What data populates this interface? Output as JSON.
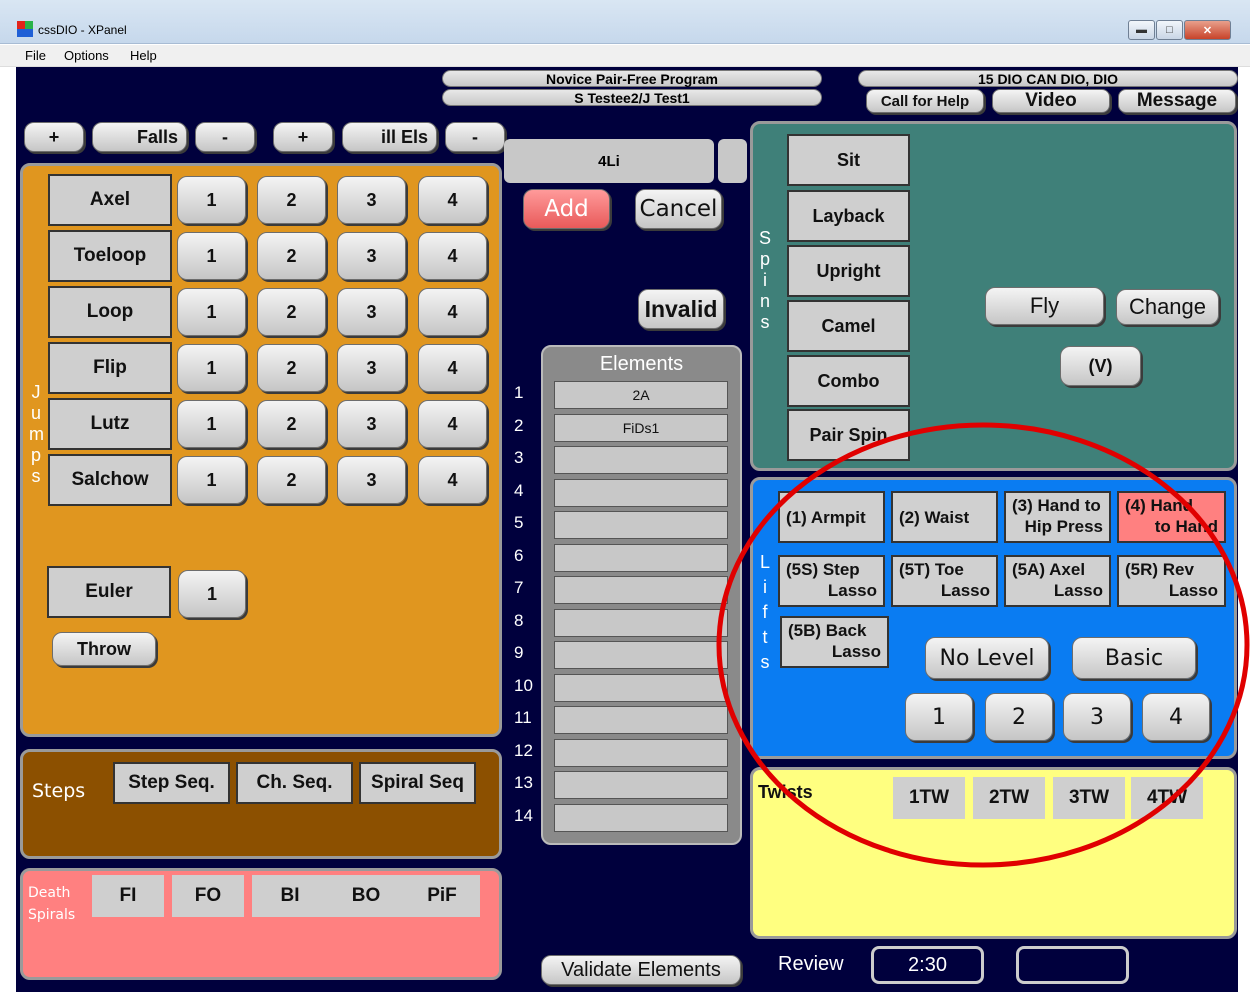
{
  "window": {
    "title": "cssDIO - XPanel",
    "controls": [
      "minimize-icon",
      "maximize-icon",
      "close-icon"
    ]
  },
  "menu": [
    "File",
    "Options",
    "Help"
  ],
  "header": {
    "program": "Novice Pair-Free Program",
    "skaters": "S Testee2/J Test1",
    "station": "15 DIO CAN DIO, DIO",
    "call_help": "Call for Help",
    "video": "Video",
    "message": "Message"
  },
  "counters": {
    "plus": "+",
    "minus": "-",
    "falls": "Falls",
    "ill_els": "ill Els"
  },
  "current_element": "4Li",
  "actions": {
    "add": "Add",
    "cancel": "Cancel",
    "invalid": "Invalid",
    "validate": "Validate Elements"
  },
  "jumps": {
    "label": [
      "J",
      "u",
      "m",
      "p",
      "s"
    ],
    "rows": [
      {
        "name": "Axel",
        "levels": [
          "1",
          "2",
          "3",
          "4"
        ]
      },
      {
        "name": "Toeloop",
        "levels": [
          "1",
          "2",
          "3",
          "4"
        ]
      },
      {
        "name": "Loop",
        "levels": [
          "1",
          "2",
          "3",
          "4"
        ]
      },
      {
        "name": "Flip",
        "levels": [
          "1",
          "2",
          "3",
          "4"
        ]
      },
      {
        "name": "Lutz",
        "levels": [
          "1",
          "2",
          "3",
          "4"
        ]
      },
      {
        "name": "Salchow",
        "levels": [
          "1",
          "2",
          "3",
          "4"
        ]
      }
    ],
    "euler": "Euler",
    "euler_level": "1",
    "throw": "Throw"
  },
  "steps": {
    "label": "Steps",
    "buttons": [
      "Step Seq.",
      "Ch. Seq.",
      "Spiral Seq"
    ]
  },
  "death_spirals": {
    "label_line1": "Death",
    "label_line2": "Spirals",
    "buttons": [
      "FI",
      "FO",
      "BI",
      "BO",
      "PiF"
    ]
  },
  "elements": {
    "title": "Elements",
    "numbers": [
      "1",
      "2",
      "3",
      "4",
      "5",
      "6",
      "7",
      "8",
      "9",
      "10",
      "11",
      "12",
      "13",
      "14"
    ],
    "slots": [
      "2A",
      "FiDs1",
      "",
      "",
      "",
      "",
      "",
      "",
      "",
      "",
      "",
      "",
      "",
      ""
    ]
  },
  "spins": {
    "label": [
      "S",
      "p",
      "i",
      "n",
      "s"
    ],
    "buttons": [
      "Sit",
      "Layback",
      "Upright",
      "Camel",
      "Combo",
      "Pair Spin"
    ],
    "fly": "Fly",
    "change": "Change",
    "v": "(V)"
  },
  "lifts": {
    "label": [
      "L",
      "i",
      "f",
      "t",
      "s"
    ],
    "row1": [
      {
        "line1": "(1) Armpit",
        "line2": ""
      },
      {
        "line1": "(2) Waist",
        "line2": ""
      },
      {
        "line1": "(3) Hand to",
        "line2": "Hip Press"
      },
      {
        "line1": "(4) Hand",
        "line2": "to Hand",
        "selected": true
      }
    ],
    "row2": [
      {
        "line1": "(5S) Step",
        "line2": "Lasso"
      },
      {
        "line1": "(5T) Toe",
        "line2": "Lasso"
      },
      {
        "line1": "(5A) Axel",
        "line2": "Lasso"
      },
      {
        "line1": "(5R) Rev",
        "line2": "Lasso"
      }
    ],
    "row3": {
      "line1": "(5B) Back",
      "line2": "Lasso"
    },
    "no_level": "No Level",
    "basic": "Basic",
    "levels": [
      "1",
      "2",
      "3",
      "4"
    ],
    "selected_color": "#ff8080"
  },
  "twists": {
    "label": "Twists",
    "buttons": [
      "1TW",
      "2TW",
      "3TW",
      "4TW"
    ]
  },
  "review": {
    "label": "Review",
    "time": "2:30",
    "extra": ""
  },
  "colors": {
    "background": "#00003d",
    "jumps_panel": "#e0961f",
    "steps_panel": "#8c5000",
    "death_panel": "#ff8080",
    "spins_panel": "#3f8079",
    "lifts_panel": "#0a7cf2",
    "twists_panel": "#ffff80",
    "annotation_circle": "#e00000"
  }
}
